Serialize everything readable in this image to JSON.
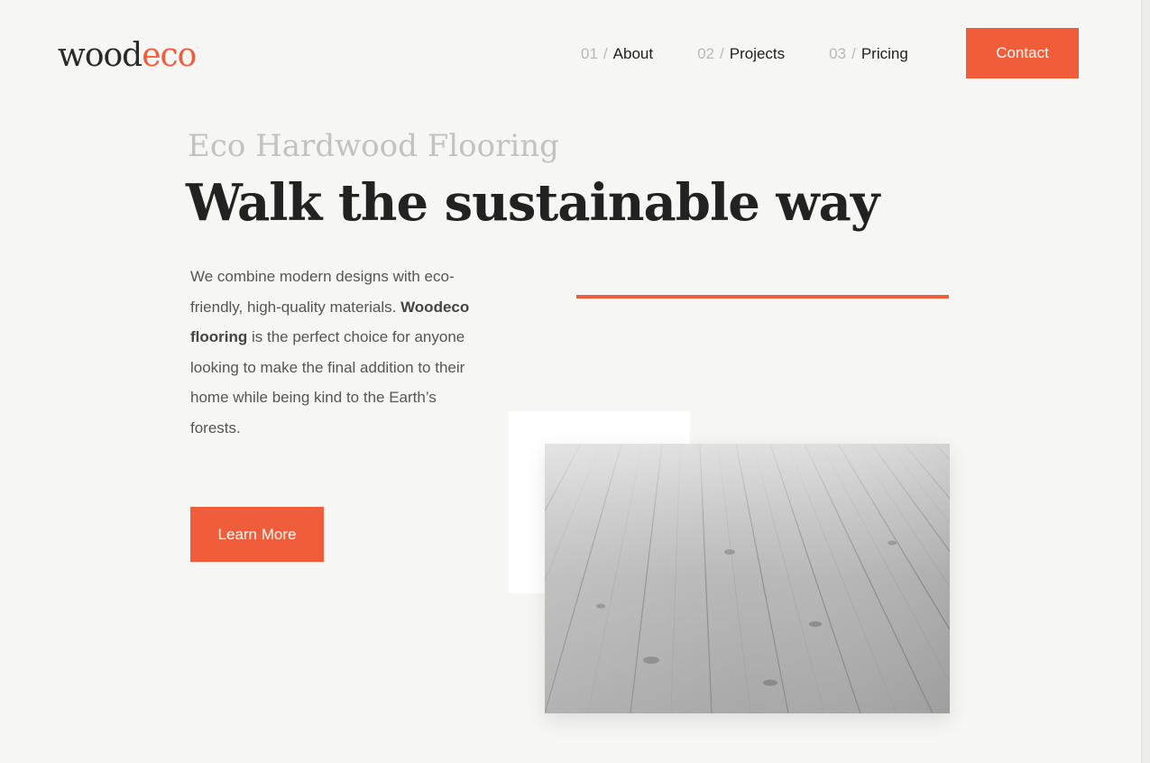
{
  "logo": {
    "part1": "wood",
    "part2": "eco"
  },
  "nav": {
    "items": [
      {
        "num": "01",
        "label": "About"
      },
      {
        "num": "02",
        "label": "Projects"
      },
      {
        "num": "03",
        "label": "Pricing"
      }
    ],
    "separator": "/",
    "contact_label": "Contact"
  },
  "hero": {
    "eyebrow": "Eco Hardwood Flooring",
    "headline": "Walk the sustainable way",
    "body_part1": "We combine modern designs with eco-friendly, high-quality materials. ",
    "body_bold": "Woodeco flooring",
    "body_part2": " is the perfect choice for anyone looking to make the final addition to their home while being kind to the Earth’s forests.",
    "cta_label": "Learn More"
  },
  "colors": {
    "accent": "#f05d3b",
    "background": "#f6f6f4",
    "text_dark": "#222222",
    "text_muted": "#c2c2c0"
  },
  "image": {
    "subject": "grey weathered wooden floor planks"
  }
}
